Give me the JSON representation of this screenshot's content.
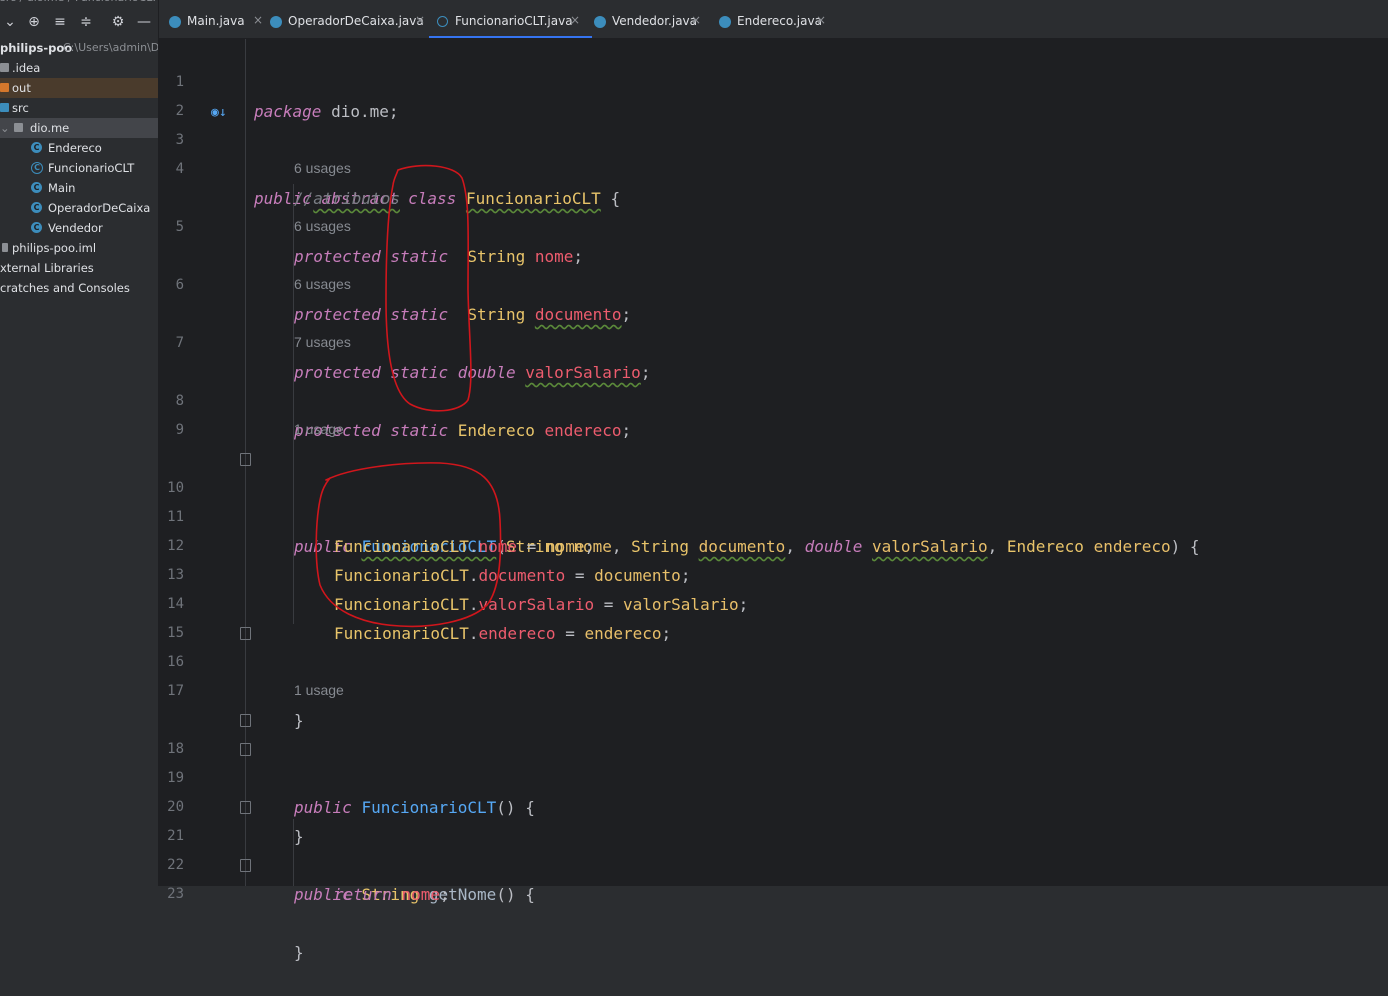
{
  "sidebar": {
    "project_name": "philips-poo",
    "project_path": "C:\\Users\\admin\\De",
    "items": [
      {
        "label": ".idea"
      },
      {
        "label": "out"
      },
      {
        "label": "src"
      },
      {
        "label": "dio.me"
      },
      {
        "label": "Endereco"
      },
      {
        "label": "FuncionarioCLT"
      },
      {
        "label": "Main"
      },
      {
        "label": "OperadorDeCaixa"
      },
      {
        "label": "Vendedor"
      },
      {
        "label": "philips-poo.iml"
      },
      {
        "label": "xternal Libraries"
      },
      {
        "label": "cratches and Consoles"
      }
    ]
  },
  "tabs": [
    {
      "label": "Main.java"
    },
    {
      "label": "OperadorDeCaixa.java"
    },
    {
      "label": "FuncionarioCLT.java"
    },
    {
      "label": "Vendedor.java"
    },
    {
      "label": "Endereco.java"
    }
  ],
  "editor": {
    "hints": {
      "h1": "6 usages",
      "h2": "6 usages",
      "h3": "6 usages",
      "h4": "7 usages",
      "h5": "1 usage",
      "h6": "1 usage"
    },
    "line_numbers": [
      "1",
      "2",
      "3",
      "4",
      "5",
      "6",
      "7",
      "8",
      "9",
      "10",
      "11",
      "12",
      "13",
      "14",
      "15",
      "16",
      "17",
      "18",
      "19",
      "20",
      "21",
      "22",
      "23"
    ],
    "code": {
      "l1_pkg": "package",
      "l1_rest": " dio.me;",
      "l3_public": "public",
      "l3_abstract": "abstract",
      "l3_class": "class",
      "l3_name": "FuncionarioCLT",
      "l3_brace": " {",
      "l4_comment_slash": "//",
      "l4_comment": "atributos",
      "protected": "protected",
      "static": "static",
      "l5_type": "String",
      "l5_name": "nome",
      "l6_type": "String",
      "l6_name": "documento",
      "l7_type": "double",
      "l7_name": "valorSalario",
      "l8_type": "Endereco",
      "l8_name": "endereco",
      "semi": ";",
      "l10_public": "public",
      "l10_name": "FuncionarioCLT",
      "l10_open": "(",
      "l10_t1": "String",
      "l10_p1": "nome",
      "comma": ", ",
      "l10_t2": "String",
      "l10_p2": "documento",
      "l10_t3": "double",
      "l10_p3": "valorSalario",
      "l10_t4": "Endereco",
      "l10_p4": "endereco",
      "l10_close": ") {",
      "cls_ref": "FuncionarioCLT",
      "dot": ".",
      "l11_f": "nome",
      "l11_v": "nome",
      "l12_f": "documento",
      "l12_v": "documento",
      "l13_f": "valorSalario",
      "l13_v": "valorSalario",
      "l14_f": "endereco",
      "l14_v": "endereco",
      "eq": " = ",
      "close_brace": "}",
      "l18_public": "public",
      "l18_name": "FuncionarioCLT",
      "l18_rest": "() {",
      "l21_public": "public",
      "l21_type": "String",
      "l21_name": "getNome",
      "l21_rest": "() {",
      "l22_return": "return",
      "l22_val": "nome"
    }
  },
  "colors": {
    "keyword": "#c77dbb",
    "class_name": "#e8c46a",
    "field": "#ed5c6e",
    "method": "#56a8f5",
    "annotation_ink": "#d0161c"
  }
}
